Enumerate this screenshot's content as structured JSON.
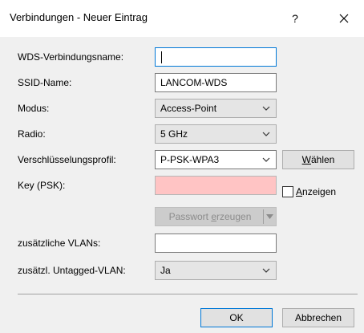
{
  "window": {
    "title": "Verbindungen - Neuer Eintrag",
    "help_label": "?"
  },
  "form": {
    "wds_name": {
      "label": "WDS-Verbindungsname:",
      "value": ""
    },
    "ssid": {
      "label": "SSID-Name:",
      "value": "LANCOM-WDS"
    },
    "mode": {
      "label": "Modus:",
      "value": "Access-Point"
    },
    "radio": {
      "label": "Radio:",
      "value": "5 GHz"
    },
    "encryption": {
      "label": "Verschlüsselungsprofil:",
      "value": "P-PSK-WPA3",
      "choose_prefix": "",
      "choose_mnemonic": "W",
      "choose_rest": "ählen"
    },
    "psk": {
      "label": "Key (PSK):",
      "value": "",
      "show_mnemonic": "A",
      "show_rest": "nzeigen",
      "show_checked": false
    },
    "generate": {
      "prefix": "Passwort ",
      "mnemonic": "e",
      "rest": "rzeugen"
    },
    "vlans": {
      "label": "zusätzliche VLANs:",
      "value": ""
    },
    "untagged": {
      "label": "zusätzl. Untagged-VLAN:",
      "value": "Ja"
    }
  },
  "footer": {
    "ok_label": "OK",
    "cancel_label": "Abbrechen"
  },
  "colors": {
    "accent": "#0078d7",
    "invalid_field": "#ffc4c4"
  }
}
